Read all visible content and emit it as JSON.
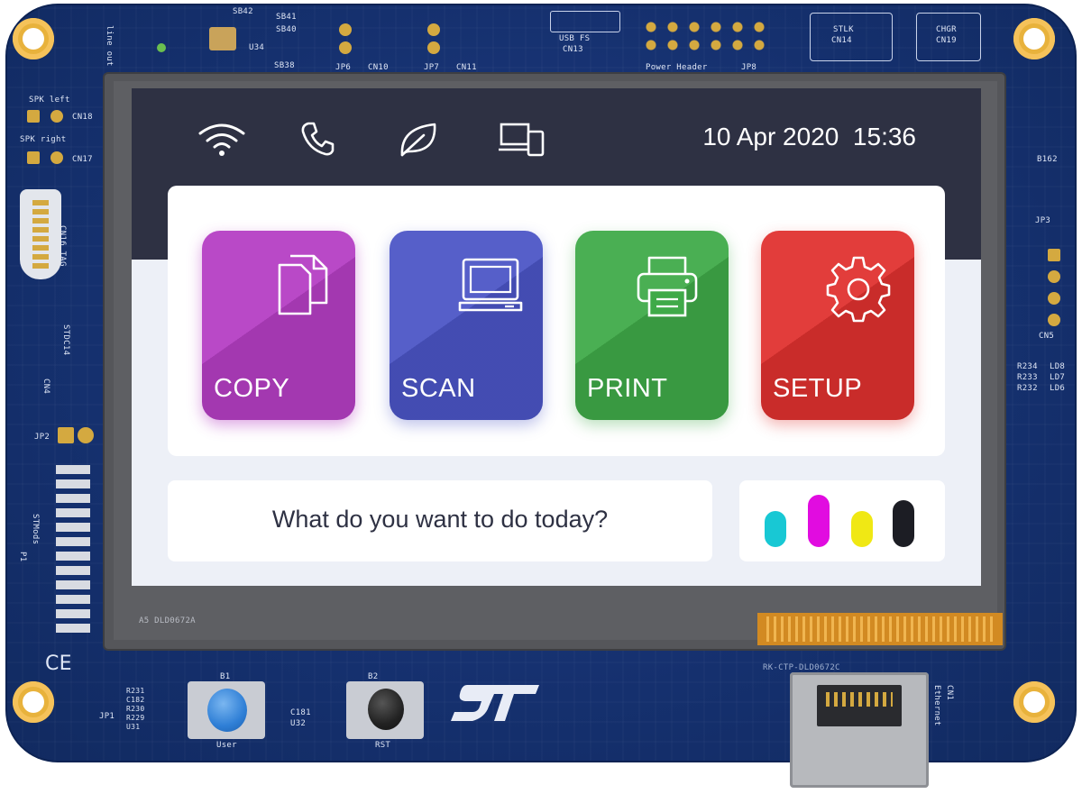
{
  "statusbar": {
    "icons": [
      "wifi-icon",
      "phone-icon",
      "leaf-icon",
      "devices-icon"
    ],
    "date": "10 Apr 2020",
    "time": "15:36"
  },
  "tiles": [
    {
      "label": "COPY",
      "icon": "copy-icon",
      "color": "#b53ec4"
    },
    {
      "label": "SCAN",
      "icon": "scan-icon",
      "color": "#4b55c6"
    },
    {
      "label": "PRINT",
      "icon": "print-icon",
      "color": "#3faa48"
    },
    {
      "label": "SETUP",
      "icon": "gear-icon",
      "color": "#e0312f"
    }
  ],
  "prompt": "What do you want to do today?",
  "ink_levels": [
    {
      "color": "#18c8d4",
      "name": "cyan"
    },
    {
      "color": "#e10ce0",
      "name": "magenta"
    },
    {
      "color": "#f0e814",
      "name": "yellow"
    },
    {
      "color": "#1c1d24",
      "name": "black"
    }
  ],
  "board": {
    "lcd_code": "A5 DLD0672A",
    "ribbon_code": "RK-CTP-DLD0672C",
    "user_button_label": "User",
    "user_button_ref": "B1",
    "reset_button_label": "RST",
    "reset_button_ref": "B2",
    "ce_mark": "CE",
    "silk": {
      "spk_left": "SPK left",
      "cn18": "CN18",
      "spk_right": "SPK right",
      "cn17": "CN17",
      "cn16": "CN16 TAG",
      "jp2": "JP2",
      "jp1": "JP1",
      "u31": "U31",
      "u32": "U32",
      "c181": "C181",
      "r231": "R231",
      "c182": "C182",
      "r230": "R230",
      "r229": "R229",
      "stlk": "STLK",
      "cn14": "CN14",
      "chgr": "CHGR",
      "cn19": "CN19",
      "usb_fs": "USB FS",
      "cn13": "CN13",
      "power_header": "Power Header",
      "jp8": "JP8",
      "jp6": "JP6",
      "jp7": "JP7",
      "cn10": "CN10",
      "cn11": "CN11",
      "b162": "B162",
      "jp3": "JP3",
      "cn5": "CN5",
      "r234": "R234",
      "r233": "R233",
      "r232": "R232",
      "ld8": "LD8",
      "ld7": "LD7",
      "ld6": "LD6",
      "ethernet": "Ethernet",
      "cn1": "CN1",
      "stdc14": "STDC14",
      "cn4": "CN4",
      "stmods": "STMods",
      "p1": "P1",
      "sb42": "SB42",
      "sb41": "SB41",
      "sb40": "SB40",
      "sb38": "SB38",
      "u34": "U34",
      "line_out": "line out"
    }
  }
}
